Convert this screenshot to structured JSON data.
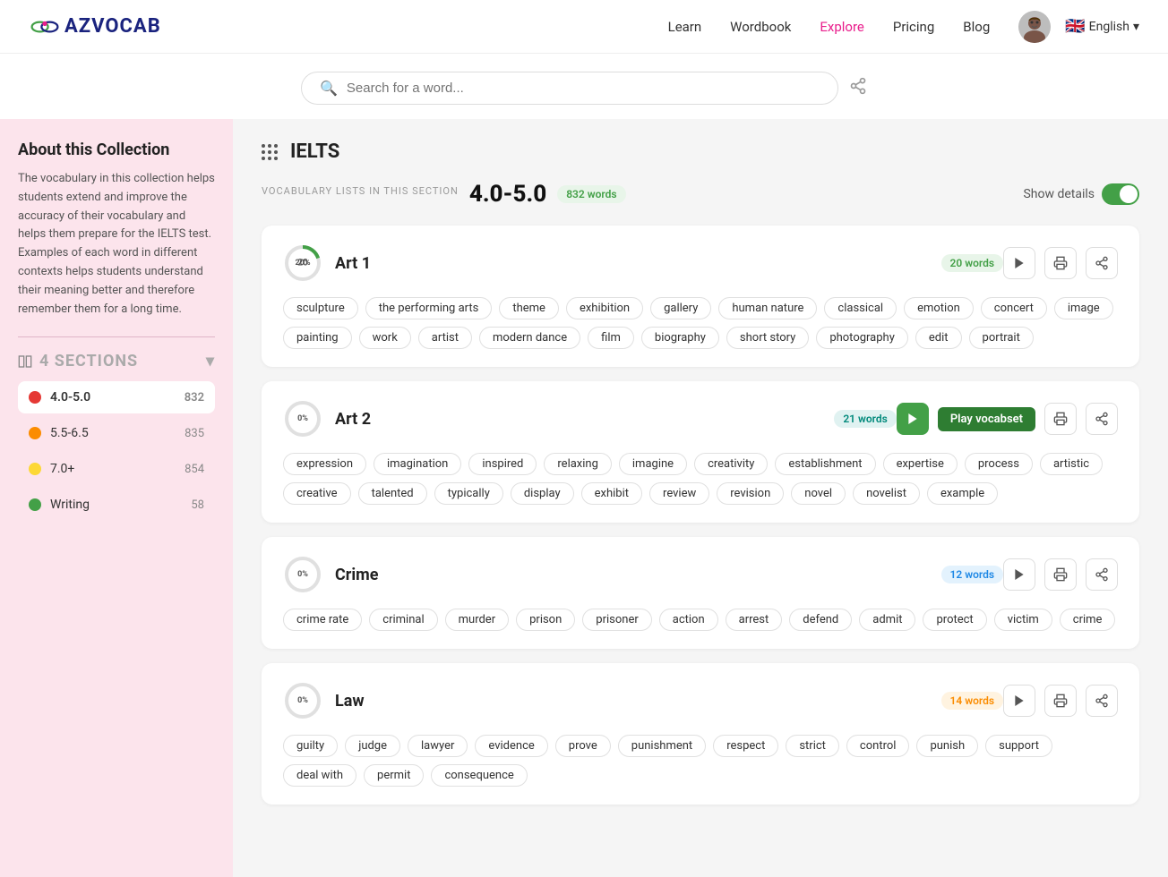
{
  "navbar": {
    "logo_text": "AZVOCAB",
    "links": [
      "Learn",
      "Wordbook",
      "Explore",
      "Pricing",
      "Blog"
    ],
    "lang": "English"
  },
  "search": {
    "placeholder": "Search for a word..."
  },
  "breadcrumb": {
    "page_title": "IELTS"
  },
  "section_header": {
    "label": "VOCABULARY LISTS IN THIS SECTION",
    "score": "4.0-5.0",
    "word_count": "832 words",
    "show_details": "Show details"
  },
  "sidebar": {
    "title": "About this Collection",
    "description": "The vocabulary in this collection helps students extend and improve the accuracy of their vocabulary and helps them prepare for the IELTS test. Examples of each word in different contexts helps students understand their meaning better and therefore remember them for a long time.",
    "sections_label": "4 SECTIONS",
    "items": [
      {
        "id": "4.0-5.0",
        "label": "4.0-5.0",
        "count": 832,
        "color": "#e53935",
        "active": true
      },
      {
        "id": "5.5-6.5",
        "label": "5.5-6.5",
        "count": 835,
        "color": "#fb8c00",
        "active": false
      },
      {
        "id": "7.0+",
        "label": "7.0+",
        "count": 854,
        "color": "#fdd835",
        "active": false
      },
      {
        "id": "writing",
        "label": "Writing",
        "count": 58,
        "color": "#43a047",
        "active": false
      }
    ]
  },
  "lists": [
    {
      "id": "art1",
      "title": "Art 1",
      "progress": 20,
      "word_count": "20 words",
      "badge_class": "badge-green",
      "has_active_play": false,
      "tags": [
        "sculpture",
        "the performing arts",
        "theme",
        "exhibition",
        "gallery",
        "human nature",
        "classical",
        "emotion",
        "concert",
        "image",
        "painting",
        "work",
        "artist",
        "modern dance",
        "film",
        "biography",
        "short story",
        "photography",
        "edit",
        "portrait"
      ]
    },
    {
      "id": "art2",
      "title": "Art 2",
      "progress": 0,
      "word_count": "21 words",
      "badge_class": "badge-teal",
      "has_active_play": true,
      "play_tooltip": "Play vocabset",
      "tags": [
        "expression",
        "imagination",
        "inspired",
        "relaxing",
        "imagine",
        "creativity",
        "establishment",
        "expertise",
        "process",
        "artistic",
        "creative",
        "talented",
        "typically",
        "display",
        "exhibit",
        "review",
        "revision",
        "novel",
        "novelist",
        "example"
      ]
    },
    {
      "id": "crime",
      "title": "Crime",
      "progress": 0,
      "word_count": "12 words",
      "badge_class": "badge-blue",
      "has_active_play": false,
      "tags": [
        "crime rate",
        "criminal",
        "murder",
        "prison",
        "prisoner",
        "action",
        "arrest",
        "defend",
        "admit",
        "protect",
        "victim",
        "crime"
      ]
    },
    {
      "id": "law",
      "title": "Law",
      "progress": 0,
      "word_count": "14 words",
      "badge_class": "badge-orange",
      "has_active_play": false,
      "tags": [
        "guilty",
        "judge",
        "lawyer",
        "evidence",
        "prove",
        "punishment",
        "respect",
        "strict",
        "control",
        "punish",
        "support",
        "deal with",
        "permit",
        "consequence"
      ]
    }
  ],
  "icons": {
    "search": "🔍",
    "share": "⋯",
    "play": "▶",
    "print": "🖨",
    "share_card": "↗"
  }
}
